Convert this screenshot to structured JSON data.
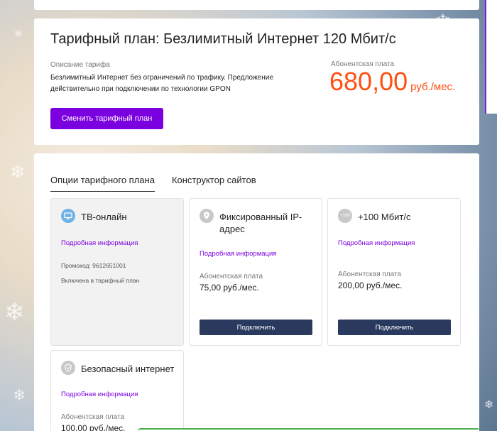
{
  "tariff": {
    "title": "Тарифный план: Безлимитный Интернет 120 Мбит/с",
    "description_label": "Описание тарифа",
    "description_text": "Безлимитный Интернет без ограничений по трафику. Предложение действительно при подключении по технологии GPON",
    "fee_label": "Абонентская плата",
    "fee_amount": "680,00",
    "fee_unit": "руб./мес.",
    "change_button": "Сменить тарифный план"
  },
  "tabs": [
    {
      "label": "Опции тарифного плана",
      "active": true
    },
    {
      "label": "Конструктор сайтов",
      "active": false
    }
  ],
  "options": [
    {
      "title": "ТВ-онлайн",
      "icon": "tv-icon",
      "link": "Подробная информация",
      "promo": "Промокод: 9612651001",
      "included": "Включена в тарифный план"
    },
    {
      "title": "Фиксированный IP-адрес",
      "icon": "location-pin-icon",
      "link": "Подробная информация",
      "fee_label": "Абонентская плата",
      "fee": "75,00 руб./мес.",
      "button": "Подключить"
    },
    {
      "title": "+100 Мбит/с",
      "icon": "speed-plus-icon",
      "icon_text": "+100",
      "link": "Подробная информация",
      "fee_label": "Абонентская плата",
      "fee": "200,00 руб./мес.",
      "button": "Подключить"
    },
    {
      "title": "Безопасный интернет",
      "icon": "shield-icon",
      "link": "Подробная информация",
      "fee_label": "Абонентская плата",
      "fee": "100,00 руб./мес."
    }
  ],
  "colors": {
    "accent": "#7b00e0",
    "price": "#ff4f12",
    "button_dark": "#2a3a5e"
  }
}
